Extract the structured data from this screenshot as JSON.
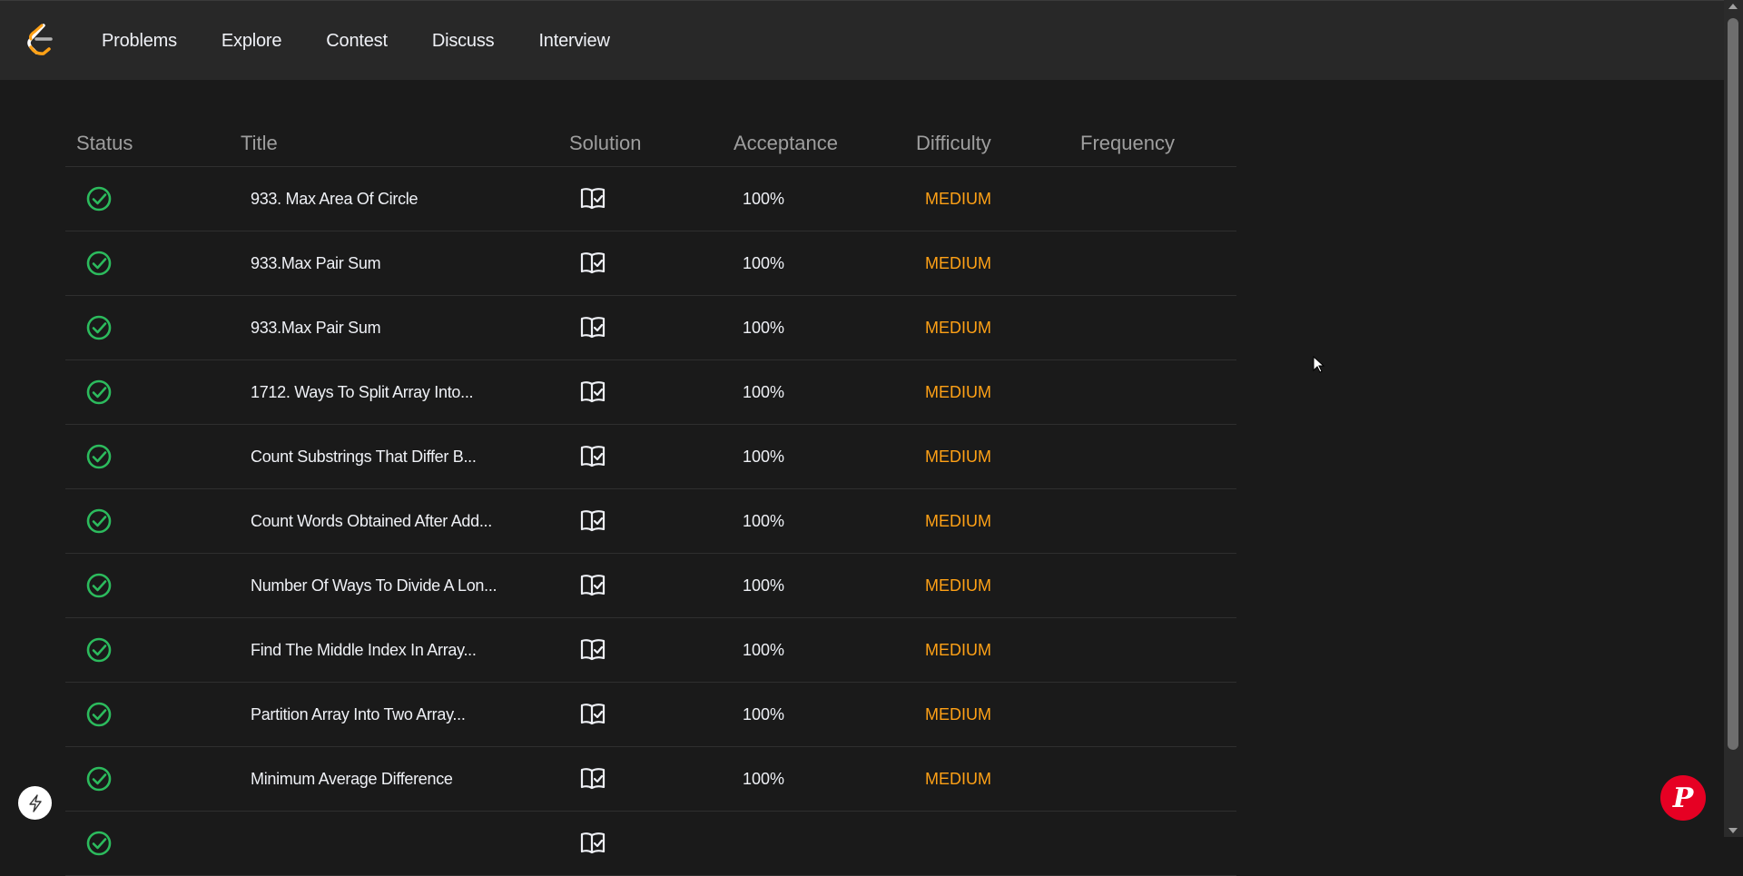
{
  "nav": {
    "logo_icon": "leetcode-logo-icon",
    "links": [
      "Problems",
      "Explore",
      "Contest",
      "Discuss",
      "Interview"
    ]
  },
  "table": {
    "headers": {
      "status": "Status",
      "title": "Title",
      "solution": "Solution",
      "acceptance": "Acceptance",
      "difficulty": "Difficulty",
      "frequency": "Frequency"
    },
    "rows": [
      {
        "title": "933. Max Area Of Circle",
        "acceptance": "100%",
        "difficulty": "MEDIUM"
      },
      {
        "title": "933.Max Pair Sum",
        "acceptance": "100%",
        "difficulty": "MEDIUM"
      },
      {
        "title": "933.Max Pair Sum",
        "acceptance": "100%",
        "difficulty": "MEDIUM"
      },
      {
        "title": "1712. Ways To Split Array Into...",
        "acceptance": "100%",
        "difficulty": "MEDIUM"
      },
      {
        "title": "Count Substrings That Differ B...",
        "acceptance": "100%",
        "difficulty": "MEDIUM"
      },
      {
        "title": "Count Words Obtained After Add...",
        "acceptance": "100%",
        "difficulty": "MEDIUM"
      },
      {
        "title": "Number Of Ways To Divide A Lon...",
        "acceptance": "100%",
        "difficulty": "MEDIUM"
      },
      {
        "title": "Find The Middle Index In Array...",
        "acceptance": "100%",
        "difficulty": "MEDIUM"
      },
      {
        "title": "Partition Array Into Two Array...",
        "acceptance": "100%",
        "difficulty": "MEDIUM"
      },
      {
        "title": "Minimum Average Difference",
        "acceptance": "100%",
        "difficulty": "MEDIUM"
      }
    ]
  },
  "colors": {
    "background": "#1a1a1a",
    "navbar": "#282828",
    "accepted_green": "#2cbb5d",
    "medium_orange": "#ffa116",
    "pinterest_red": "#e60023"
  },
  "floating": {
    "left_button_icon": "lightning-bolt-icon",
    "right_button_icon": "pinterest-icon",
    "right_button_glyph": "P"
  }
}
